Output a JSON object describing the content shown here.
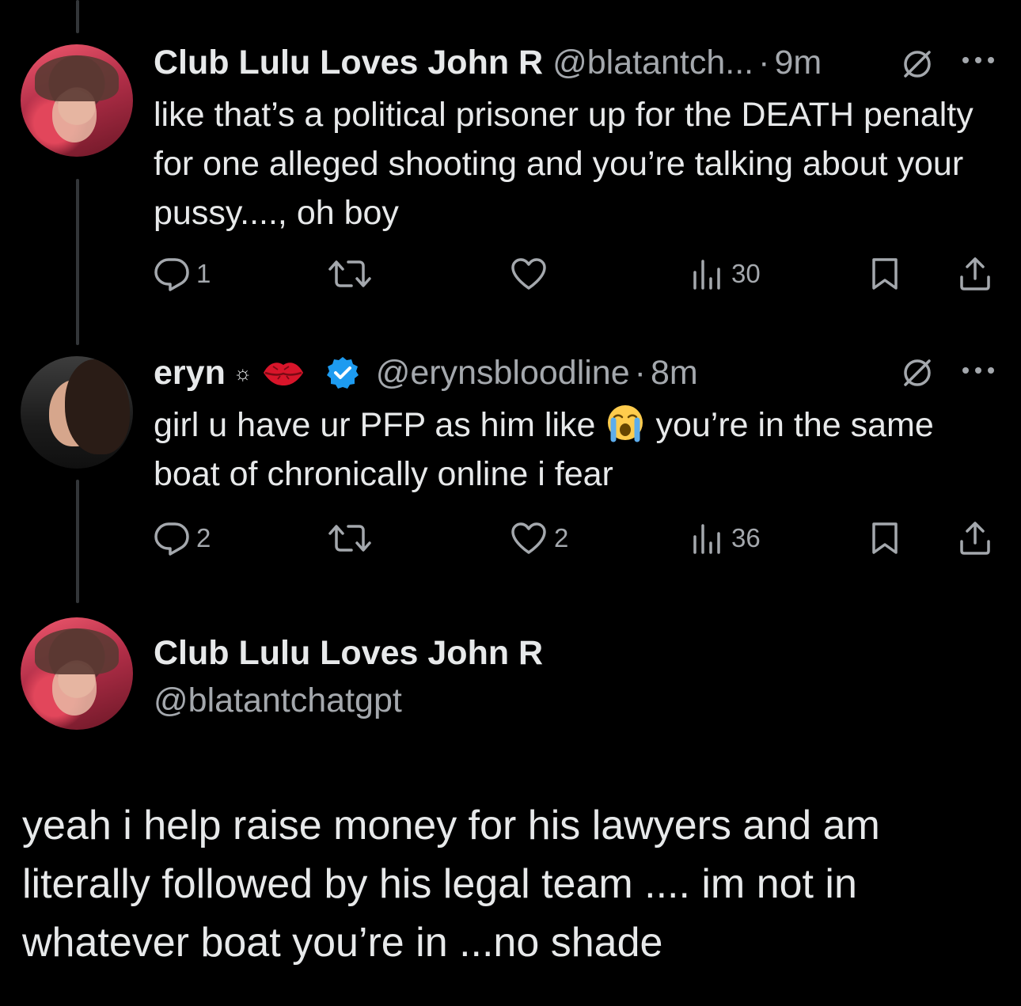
{
  "tweets": [
    {
      "display_name": "Club Lulu Loves John R",
      "handle": "@blatantch...",
      "separator": "·",
      "time": "9m",
      "text": "like that’s a political prisoner up for the DEATH penalty for one alleged shooting and you’re talking about your pussy...., oh boy",
      "replies": "1",
      "reposts": "",
      "likes": "",
      "views": "30"
    },
    {
      "display_name": "eryn",
      "badge_sun": "☼",
      "handle": "@erynsbloodline",
      "separator": "·",
      "time": "8m",
      "text_before_emoji": "girl u have ur PFP as him like",
      "text_after_emoji": "you’re in the same boat of chronically online i fear",
      "replies": "2",
      "reposts": "",
      "likes": "2",
      "views": "36"
    }
  ],
  "main_post": {
    "display_name": "Club Lulu Loves John R",
    "handle": "@blatantchatgpt",
    "text": "yeah i help raise money for his lawyers and am literally followed by his legal team .... im not in whatever boat you’re in ...no shade"
  },
  "icons": {
    "reply": "reply-icon",
    "repost": "repost-icon",
    "like": "heart-icon",
    "views": "views-icon",
    "bookmark": "bookmark-icon",
    "share": "share-icon",
    "grok": "grok-icon",
    "more": "more-icon",
    "verified": "verified-badge-icon",
    "lips": "lips-emoji",
    "crying": "loudly-crying-emoji"
  },
  "colors": {
    "background": "#000000",
    "primary_text": "#e7e9ea",
    "secondary_text": "#a4a8ad",
    "verified_blue": "#1d9bf0",
    "thread_line": "#333639"
  }
}
